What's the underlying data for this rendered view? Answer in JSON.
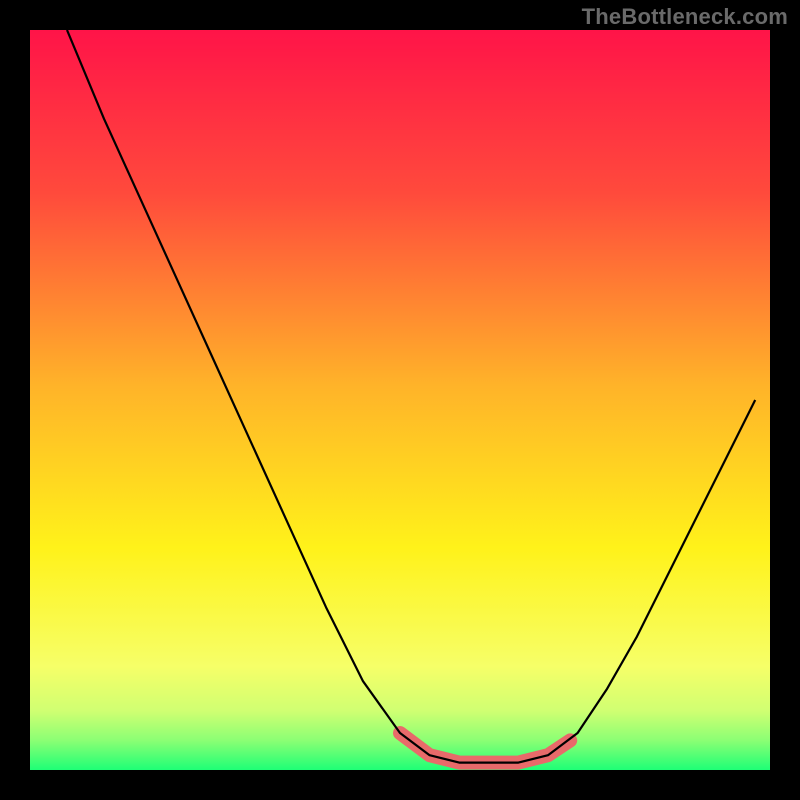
{
  "watermark": {
    "text": "TheBottleneck.com"
  },
  "chart_data": {
    "type": "line",
    "title": "",
    "xlabel": "",
    "ylabel": "",
    "xlim": [
      0,
      100
    ],
    "ylim": [
      0,
      100
    ],
    "grid": false,
    "background_gradient_stops": [
      {
        "pct": 0,
        "color": "#ff1448"
      },
      {
        "pct": 22,
        "color": "#ff4a3c"
      },
      {
        "pct": 48,
        "color": "#ffb329"
      },
      {
        "pct": 70,
        "color": "#fff21a"
      },
      {
        "pct": 86,
        "color": "#f6ff68"
      },
      {
        "pct": 92,
        "color": "#d0ff72"
      },
      {
        "pct": 96,
        "color": "#8bff74"
      },
      {
        "pct": 100,
        "color": "#1eff76"
      }
    ],
    "series": [
      {
        "name": "black-curve",
        "stroke": "#000000",
        "points": [
          {
            "x": 5,
            "y": 100
          },
          {
            "x": 10,
            "y": 88
          },
          {
            "x": 15,
            "y": 77
          },
          {
            "x": 20,
            "y": 66
          },
          {
            "x": 25,
            "y": 55
          },
          {
            "x": 30,
            "y": 44
          },
          {
            "x": 35,
            "y": 33
          },
          {
            "x": 40,
            "y": 22
          },
          {
            "x": 45,
            "y": 12
          },
          {
            "x": 50,
            "y": 5
          },
          {
            "x": 54,
            "y": 2
          },
          {
            "x": 58,
            "y": 1
          },
          {
            "x": 62,
            "y": 1
          },
          {
            "x": 66,
            "y": 1
          },
          {
            "x": 70,
            "y": 2
          },
          {
            "x": 74,
            "y": 5
          },
          {
            "x": 78,
            "y": 11
          },
          {
            "x": 82,
            "y": 18
          },
          {
            "x": 86,
            "y": 26
          },
          {
            "x": 90,
            "y": 34
          },
          {
            "x": 94,
            "y": 42
          },
          {
            "x": 98,
            "y": 50
          }
        ]
      },
      {
        "name": "red-floor-segment",
        "stroke": "#e86a6a",
        "stroke_width": 14,
        "linecap": "round",
        "points": [
          {
            "x": 50,
            "y": 5
          },
          {
            "x": 54,
            "y": 2
          },
          {
            "x": 58,
            "y": 1
          },
          {
            "x": 62,
            "y": 1
          },
          {
            "x": 66,
            "y": 1
          },
          {
            "x": 70,
            "y": 2
          },
          {
            "x": 73,
            "y": 4
          }
        ]
      }
    ]
  }
}
